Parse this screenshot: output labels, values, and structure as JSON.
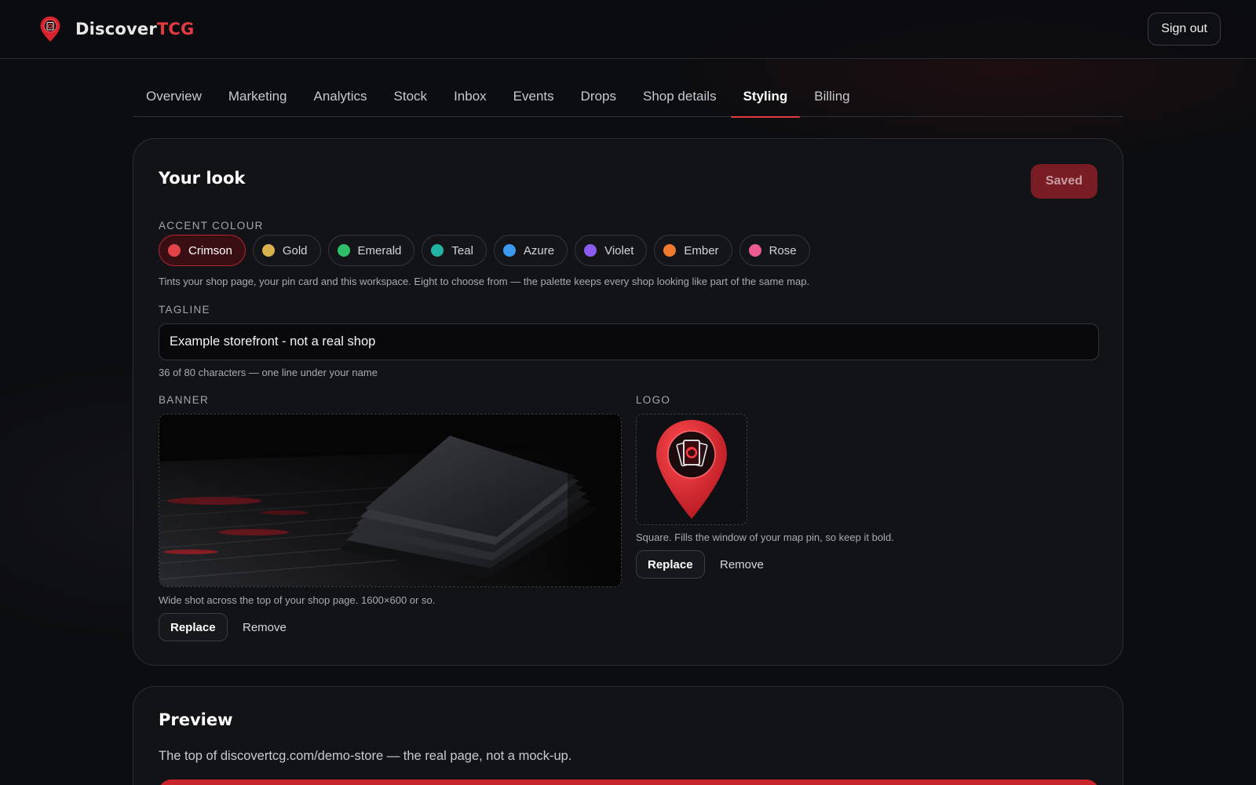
{
  "header": {
    "brand_part1": "Discover",
    "brand_part2": "TCG",
    "signout_label": "Sign out"
  },
  "tabs": [
    {
      "label": "Overview"
    },
    {
      "label": "Marketing"
    },
    {
      "label": "Analytics"
    },
    {
      "label": "Stock"
    },
    {
      "label": "Inbox"
    },
    {
      "label": "Events"
    },
    {
      "label": "Drops"
    },
    {
      "label": "Shop details"
    },
    {
      "label": "Styling",
      "active": true
    },
    {
      "label": "Billing"
    }
  ],
  "look": {
    "title": "Your look",
    "saved_label": "Saved",
    "accent_label": "Accent colour",
    "accents": [
      {
        "name": "Crimson",
        "color": "#e5434a",
        "selected": true
      },
      {
        "name": "Gold",
        "color": "#d9b24f"
      },
      {
        "name": "Emerald",
        "color": "#2fbf69"
      },
      {
        "name": "Teal",
        "color": "#22b3a3"
      },
      {
        "name": "Azure",
        "color": "#3b9af0"
      },
      {
        "name": "Violet",
        "color": "#8c5cf0"
      },
      {
        "name": "Ember",
        "color": "#f07a2e"
      },
      {
        "name": "Rose",
        "color": "#ec5c90"
      }
    ],
    "accent_help": "Tints your shop page, your pin card and this workspace. Eight to choose from — the palette keeps every shop looking like part of the same map.",
    "tagline_label": "Tagline",
    "tagline_value": "Example storefront - not a real shop",
    "tagline_help": "36 of 80 characters — one line under your name",
    "banner_label": "Banner",
    "banner_help": "Wide shot across the top of your shop page. 1600×600 or so.",
    "banner_replace": "Replace",
    "banner_remove": "Remove",
    "logo_label": "Logo",
    "logo_help": "Square. Fills the window of your map pin, so keep it bold.",
    "logo_replace": "Replace",
    "logo_remove": "Remove"
  },
  "preview": {
    "title": "Preview",
    "subtitle": "The top of discovertcg.com/demo-store — the real page, not a mock-up."
  },
  "colors": {
    "accent": "#e23a41",
    "background": "#0c0d10",
    "card": "#121317"
  }
}
